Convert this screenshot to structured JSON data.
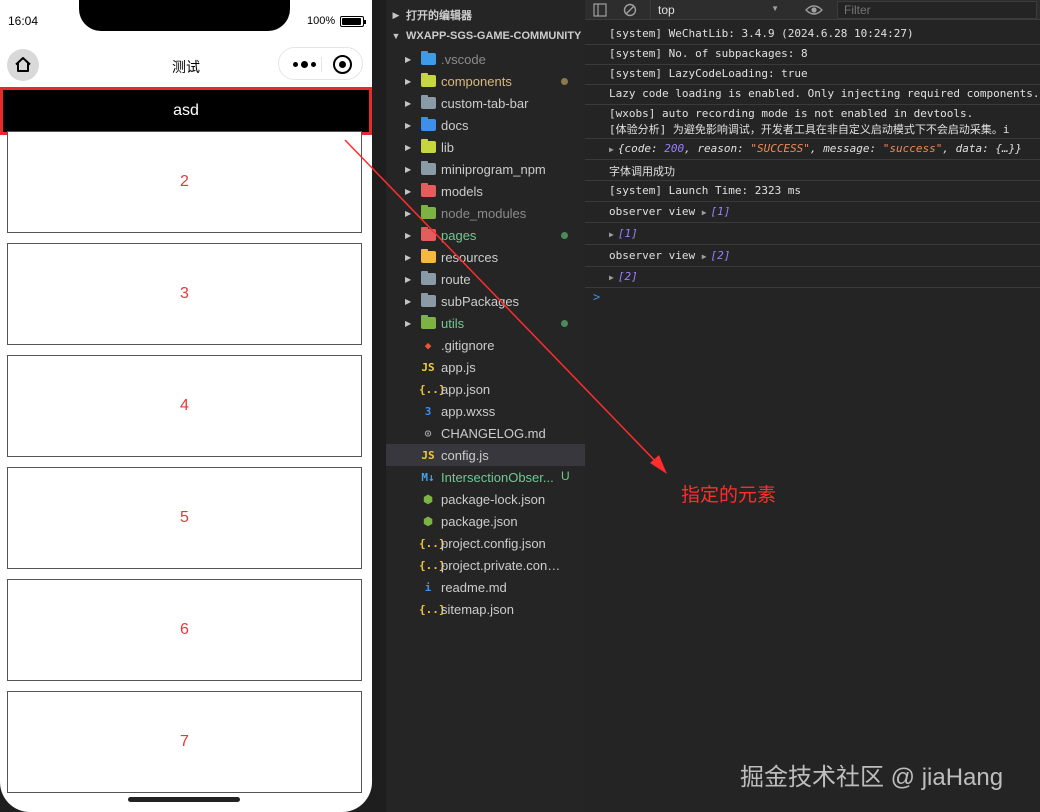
{
  "phone": {
    "status_time": "16:04",
    "battery_percent": "100%",
    "nav_title": "测试",
    "fixed_header_text": "asd",
    "list_items": [
      "2",
      "3",
      "4",
      "5",
      "6",
      "7"
    ]
  },
  "explorer": {
    "open_editors_title": "打开的编辑器",
    "project_title": "WXAPP-SGS-GAME-COMMUNITY",
    "items": [
      {
        "label": ".vscode",
        "type": "folder",
        "icon": "vscode-folder-icon",
        "color": "#3e9be9",
        "text_color": "#8b8b8b"
      },
      {
        "label": "components",
        "type": "folder",
        "icon": "components-folder-icon",
        "color": "#c5d63f",
        "text_color": "#d7ba7d",
        "status_dot": "#8b7a4e"
      },
      {
        "label": "custom-tab-bar",
        "type": "folder",
        "icon": "folder-icon",
        "color": "#8a9aa6",
        "text_color": "#cccccc"
      },
      {
        "label": "docs",
        "type": "folder",
        "icon": "docs-folder-icon",
        "color": "#3e8fe9",
        "text_color": "#cccccc"
      },
      {
        "label": "lib",
        "type": "folder",
        "icon": "lib-folder-icon",
        "color": "#c5d63f",
        "text_color": "#cccccc"
      },
      {
        "label": "miniprogram_npm",
        "type": "folder",
        "icon": "folder-icon",
        "color": "#8a9aa6",
        "text_color": "#cccccc"
      },
      {
        "label": "models",
        "type": "folder",
        "icon": "models-folder-icon",
        "color": "#e35d5d",
        "text_color": "#cccccc"
      },
      {
        "label": "node_modules",
        "type": "folder",
        "icon": "node-modules-folder-icon",
        "color": "#7cb342",
        "text_color": "#8b8b8b"
      },
      {
        "label": "pages",
        "type": "folder",
        "icon": "pages-folder-icon",
        "color": "#e35d5d",
        "text_color": "#73c991",
        "status_dot": "#4c8a5e"
      },
      {
        "label": "resources",
        "type": "folder",
        "icon": "resources-folder-icon",
        "color": "#f5b93b",
        "text_color": "#cccccc"
      },
      {
        "label": "route",
        "type": "folder",
        "icon": "folder-icon",
        "color": "#8a9aa6",
        "text_color": "#cccccc"
      },
      {
        "label": "subPackages",
        "type": "folder",
        "icon": "folder-icon",
        "color": "#8a9aa6",
        "text_color": "#cccccc"
      },
      {
        "label": "utils",
        "type": "folder",
        "icon": "utils-folder-icon",
        "color": "#7cb342",
        "text_color": "#73c991",
        "status_dot": "#4c8a5e"
      },
      {
        "label": ".gitignore",
        "type": "file",
        "icon": "git-icon",
        "glyph": "◆",
        "color": "#e8572f",
        "text_color": "#cccccc"
      },
      {
        "label": "app.js",
        "type": "file",
        "icon": "js-file-icon",
        "glyph": "JS",
        "color": "#f0c93c",
        "text_color": "#cccccc"
      },
      {
        "label": "app.json",
        "type": "file",
        "icon": "json-file-icon",
        "glyph": "{..}",
        "color": "#f5c43d",
        "text_color": "#cccccc"
      },
      {
        "label": "app.wxss",
        "type": "file",
        "icon": "css-file-icon",
        "glyph": "3",
        "color": "#3d8fe8",
        "text_color": "#cccccc"
      },
      {
        "label": "CHANGELOG.md",
        "type": "file",
        "icon": "changelog-file-icon",
        "glyph": "⊙",
        "color": "#a0a0a0",
        "text_color": "#cccccc"
      },
      {
        "label": "config.js",
        "type": "file",
        "icon": "js-file-icon",
        "glyph": "JS",
        "color": "#f0c93c",
        "text_color": "#cccccc",
        "selected": true
      },
      {
        "label": "IntersectionObser...",
        "type": "file",
        "icon": "markdown-file-icon",
        "glyph": "M↓",
        "color": "#4aa0e6",
        "text_color": "#73c991",
        "badge": "U"
      },
      {
        "label": "package-lock.json",
        "type": "file",
        "icon": "npm-file-icon",
        "glyph": "⬢",
        "color": "#7cb342",
        "text_color": "#cccccc"
      },
      {
        "label": "package.json",
        "type": "file",
        "icon": "npm-file-icon",
        "glyph": "⬢",
        "color": "#7cb342",
        "text_color": "#cccccc"
      },
      {
        "label": "project.config.json",
        "type": "file",
        "icon": "json-file-icon",
        "glyph": "{..}",
        "color": "#f5c43d",
        "text_color": "#cccccc"
      },
      {
        "label": "project.private.config.js...",
        "type": "file",
        "icon": "json-file-icon",
        "glyph": "{..}",
        "color": "#f5c43d",
        "text_color": "#cccccc"
      },
      {
        "label": "readme.md",
        "type": "file",
        "icon": "info-file-icon",
        "glyph": "i",
        "color": "#3d8fe8",
        "text_color": "#cccccc"
      },
      {
        "label": "sitemap.json",
        "type": "file",
        "icon": "json-file-icon",
        "glyph": "{..}",
        "color": "#f5c43d",
        "text_color": "#cccccc"
      }
    ]
  },
  "console": {
    "context": "top",
    "filter_placeholder": "Filter",
    "lines": [
      "[system] WeChatLib: 3.4.9 (2024.6.28 10:24:27)",
      "[system] No. of subpackages: 8",
      "[system] LazyCodeLoading: true",
      "Lazy code loading is enabled. Only injecting required components.",
      "[wxobs] auto recording mode is not enabled in devtools.",
      "[体验分析] 为避免影响调试，开发者工具在非自定义启动模式下不会启动采集。i",
      "字体调用成功",
      "[system] Launch Time: 2323 ms",
      "observer view",
      "observer view"
    ],
    "object_line": {
      "code_key": "code",
      "code_value": "200",
      "reason_key": "reason",
      "reason_value": "\"SUCCESS\"",
      "message_key": "message",
      "message_value": "\"success\"",
      "data_key": "data",
      "data_value": "{…}"
    },
    "array_values": [
      "[1]",
      "[1]",
      "[2]",
      "[2]"
    ],
    "prompt": ">"
  },
  "annotation": {
    "label": "指定的元素",
    "color": "#ff2d2d"
  },
  "watermark": "掘金技术社区 @ jiaHang"
}
